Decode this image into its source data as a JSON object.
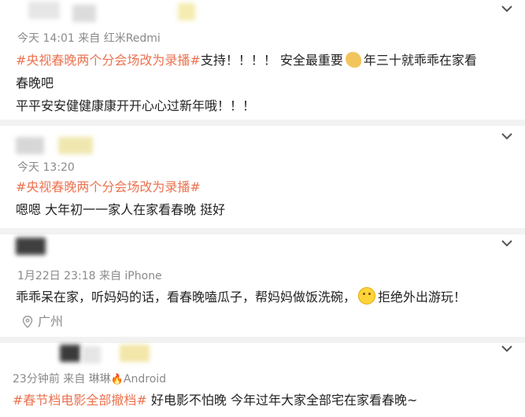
{
  "posts": [
    {
      "meta": "今天 14:01 来自 红米Redmi",
      "tag": "#央视春晚两个分会场改为录播#",
      "line1_after_tag": "支持！！！！ 安全最重要",
      "line1_after_emoji": "年三十就乖乖在家看",
      "line2": "春晚吧",
      "line3": "平平安安健健康康开开心心过新年哦！！！"
    },
    {
      "meta": "今天 13:20",
      "tag": "#央视春晚两个分会场改为录播#",
      "line2": "嗯嗯 大年初一一家人在家看春晚 挺好"
    },
    {
      "meta": "1月22日 23:18 来自 iPhone",
      "text_before_emoji": "乖乖呆在家，听妈妈的话，看春晚嗑瓜子，帮妈妈做饭洗碗，",
      "text_after_emoji": "拒绝外出游玩！",
      "location": "广州"
    },
    {
      "meta_before_fire": "23分钟前 来自 琳琳",
      "meta_after_fire": "Android",
      "tag": "#春节档电影全部撤档#",
      "text_after_tag": "好电影不怕晚  今年过年大家全部宅在家看春晚~"
    }
  ],
  "colors": {
    "tag": "#eb7350",
    "meta": "#8a8a8a",
    "text": "#222222",
    "divider": "#f2f2f2"
  },
  "icons": [
    "chevron-down-icon",
    "location-pin-icon",
    "flexed-biceps-emoji",
    "smiling-face-emoji",
    "fire-emoji"
  ]
}
